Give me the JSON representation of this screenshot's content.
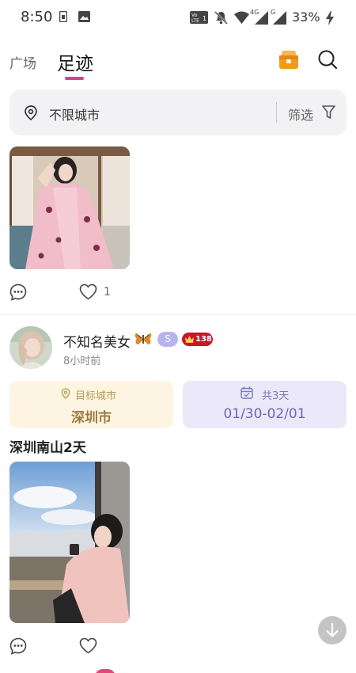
{
  "status_bar": {
    "time": "8:50",
    "battery": "33%",
    "icons": [
      "sim-card-icon",
      "image-icon",
      "volte-icon",
      "bell-off-icon",
      "wifi-icon",
      "signal-4g-icon",
      "signal-g-icon",
      "charging-icon"
    ],
    "network_4g": "4G",
    "network_g": "G"
  },
  "header": {
    "tabs": [
      {
        "label": "广场",
        "active": false
      },
      {
        "label": "足迹",
        "active": true
      }
    ],
    "accent_color": "#d4418e"
  },
  "filter_bar": {
    "city": "不限城市",
    "filter_label": "筛选"
  },
  "posts": [
    {
      "like_count": "1"
    },
    {
      "username": "不知名美女",
      "badge_s": "S",
      "level": "138",
      "time_ago": "8小时前",
      "target_city_label": "目标城市",
      "target_city": "深圳市",
      "days_label": "共3天",
      "date_range": "01/30-02/01",
      "title": "深圳南山2天"
    }
  ],
  "colors": {
    "city_card_bg": "#fdf5e1",
    "days_card_bg": "#ebe8f9",
    "level_badge": "#c8162a"
  }
}
